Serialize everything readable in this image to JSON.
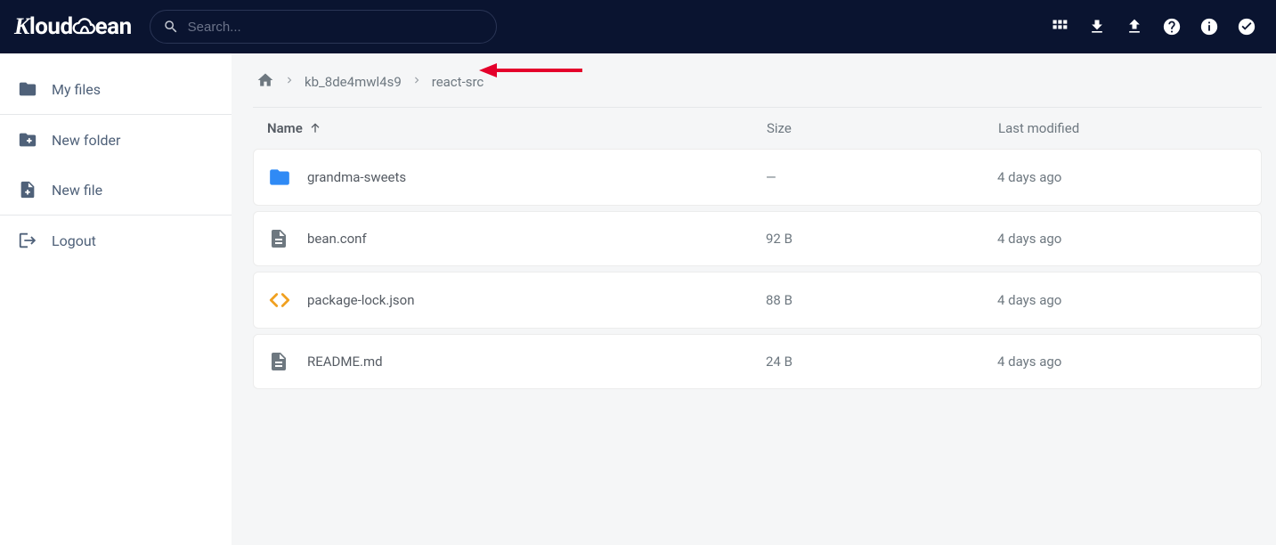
{
  "brand": "Kloudbean",
  "search": {
    "placeholder": "Search..."
  },
  "sidebar": {
    "items": [
      {
        "label": "My files"
      },
      {
        "label": "New folder"
      },
      {
        "label": "New file"
      },
      {
        "label": "Logout"
      }
    ]
  },
  "breadcrumb": {
    "items": [
      "kb_8de4mwl4s9",
      "react-src"
    ]
  },
  "table": {
    "headers": {
      "name": "Name",
      "size": "Size",
      "modified": "Last modified"
    },
    "rows": [
      {
        "type": "folder",
        "name": "grandma-sweets",
        "size": "—",
        "modified": "4 days ago"
      },
      {
        "type": "file",
        "name": "bean.conf",
        "size": "92 B",
        "modified": "4 days ago"
      },
      {
        "type": "code",
        "name": "package-lock.json",
        "size": "88 B",
        "modified": "4 days ago"
      },
      {
        "type": "file",
        "name": "README.md",
        "size": "24 B",
        "modified": "4 days ago"
      }
    ]
  }
}
